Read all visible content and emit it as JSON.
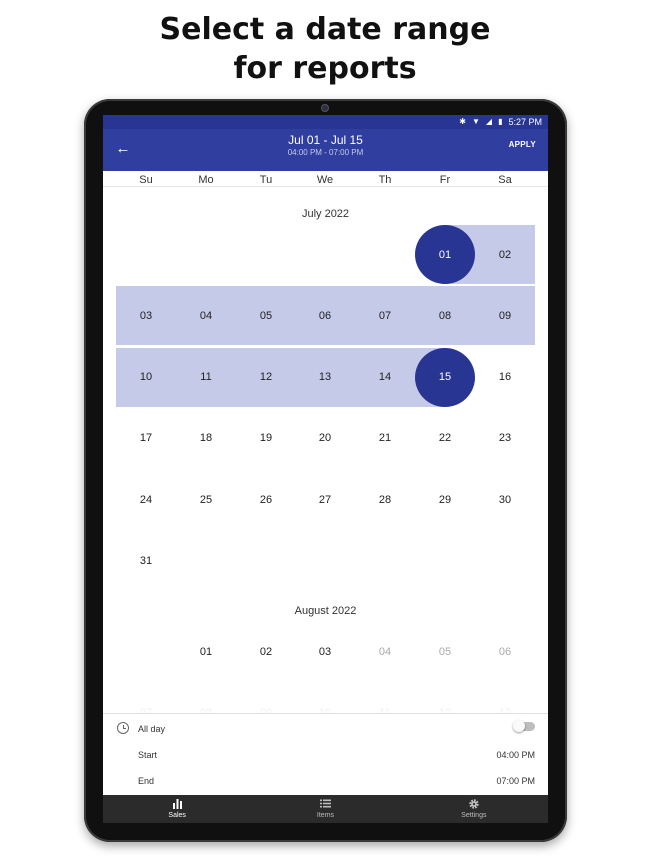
{
  "headline": {
    "line1": "Select a date range",
    "line2": "for reports"
  },
  "status_bar": {
    "time": "5:27 PM"
  },
  "app_bar": {
    "title": "Jul 01 - Jul 15",
    "subtitle": "04:00 PM - 07:00 PM",
    "apply_label": "APPLY",
    "accent_color": "#303f9f",
    "range_color": "#c5cae9"
  },
  "weekdays": [
    "Su",
    "Mo",
    "Tu",
    "We",
    "Th",
    "Fr",
    "Sa"
  ],
  "july": {
    "title": "July 2022",
    "weeks": [
      [
        "",
        "",
        "",
        "",
        "",
        "01",
        "02"
      ],
      [
        "03",
        "04",
        "05",
        "06",
        "07",
        "08",
        "09"
      ],
      [
        "10",
        "11",
        "12",
        "13",
        "14",
        "15",
        "16"
      ],
      [
        "17",
        "18",
        "19",
        "20",
        "21",
        "22",
        "23"
      ],
      [
        "24",
        "25",
        "26",
        "27",
        "28",
        "29",
        "30"
      ],
      [
        "31",
        "",
        "",
        "",
        "",
        "",
        ""
      ]
    ],
    "range_start": "01",
    "range_end": "15"
  },
  "august": {
    "title": "August 2022",
    "weeks": [
      [
        "",
        "01",
        "02",
        "03",
        "04",
        "05",
        "06"
      ],
      [
        "07",
        "08",
        "09",
        "10",
        "11",
        "12",
        "13"
      ]
    ],
    "disabled": [
      "04",
      "05",
      "06",
      "07",
      "08",
      "09",
      "10",
      "11",
      "12",
      "13"
    ]
  },
  "time_panel": {
    "all_day_label": "All day",
    "start_label": "Start",
    "start_value": "04:00 PM",
    "end_label": "End",
    "end_value": "07:00 PM"
  },
  "bottom_nav": [
    {
      "label": "Sales",
      "icon": "bar-chart-icon",
      "active": true
    },
    {
      "label": "Items",
      "icon": "list-icon",
      "active": false
    },
    {
      "label": "Settings",
      "icon": "gear-icon",
      "active": false
    }
  ]
}
